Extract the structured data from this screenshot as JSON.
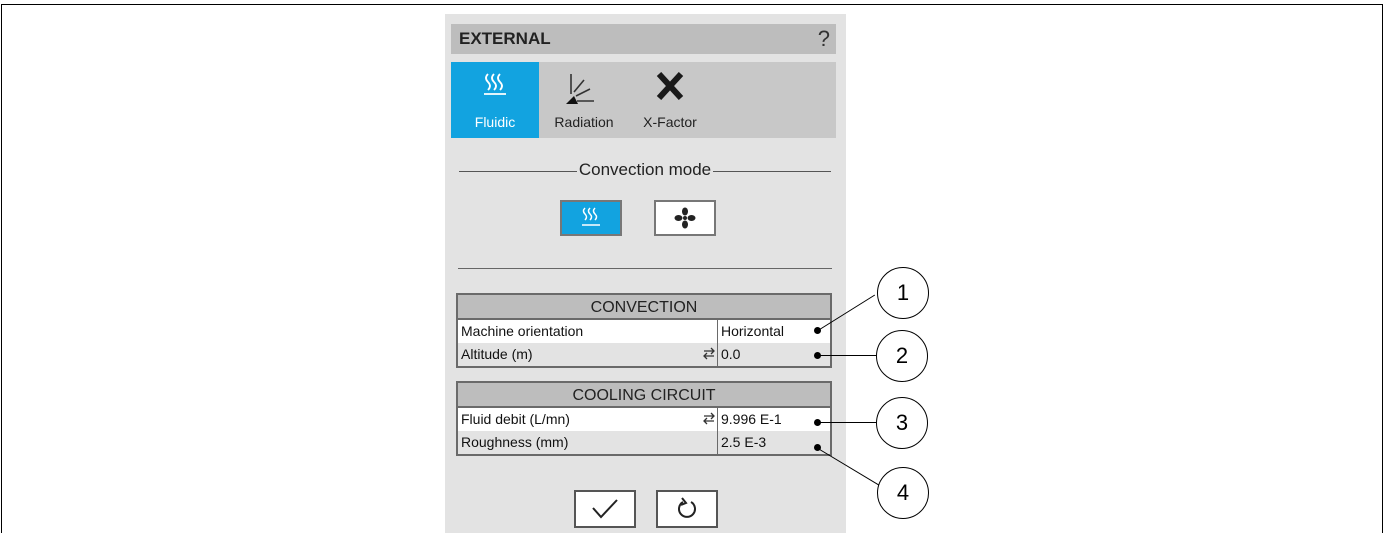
{
  "header": {
    "title": "EXTERNAL",
    "help": "?"
  },
  "tabs": [
    {
      "label": "Fluidic",
      "icon": "heat-waves-icon",
      "active": true
    },
    {
      "label": "Radiation",
      "icon": "radiation-icon",
      "active": false
    },
    {
      "label": "X-Factor",
      "icon": "x-factor-icon",
      "active": false
    }
  ],
  "convection_mode": {
    "title": "Convection mode",
    "options": [
      {
        "icon": "natural-convection-icon",
        "active": true
      },
      {
        "icon": "fan-icon",
        "active": false
      }
    ]
  },
  "convection": {
    "title": "CONVECTION",
    "rows": [
      {
        "label": "Machine orientation",
        "value": "Horizontal"
      },
      {
        "label": "Altitude (m)",
        "value": "0.0",
        "swap": true
      }
    ]
  },
  "cooling_circuit": {
    "title": "COOLING CIRCUIT",
    "rows": [
      {
        "label": "Fluid debit (L/mn)",
        "value": "9.996 E-1",
        "swap": true
      },
      {
        "label": "Roughness (mm)",
        "value": "2.5 E-3"
      }
    ]
  },
  "actions": {
    "validate_icon": "checkmark-icon",
    "reset_icon": "reset-icon"
  },
  "callouts": [
    "1",
    "2",
    "3",
    "4"
  ],
  "colors": {
    "accent": "#12a3e0",
    "panel": "#e3e3e3",
    "header": "#bdbdbd",
    "tabbar": "#c8c8c8"
  }
}
